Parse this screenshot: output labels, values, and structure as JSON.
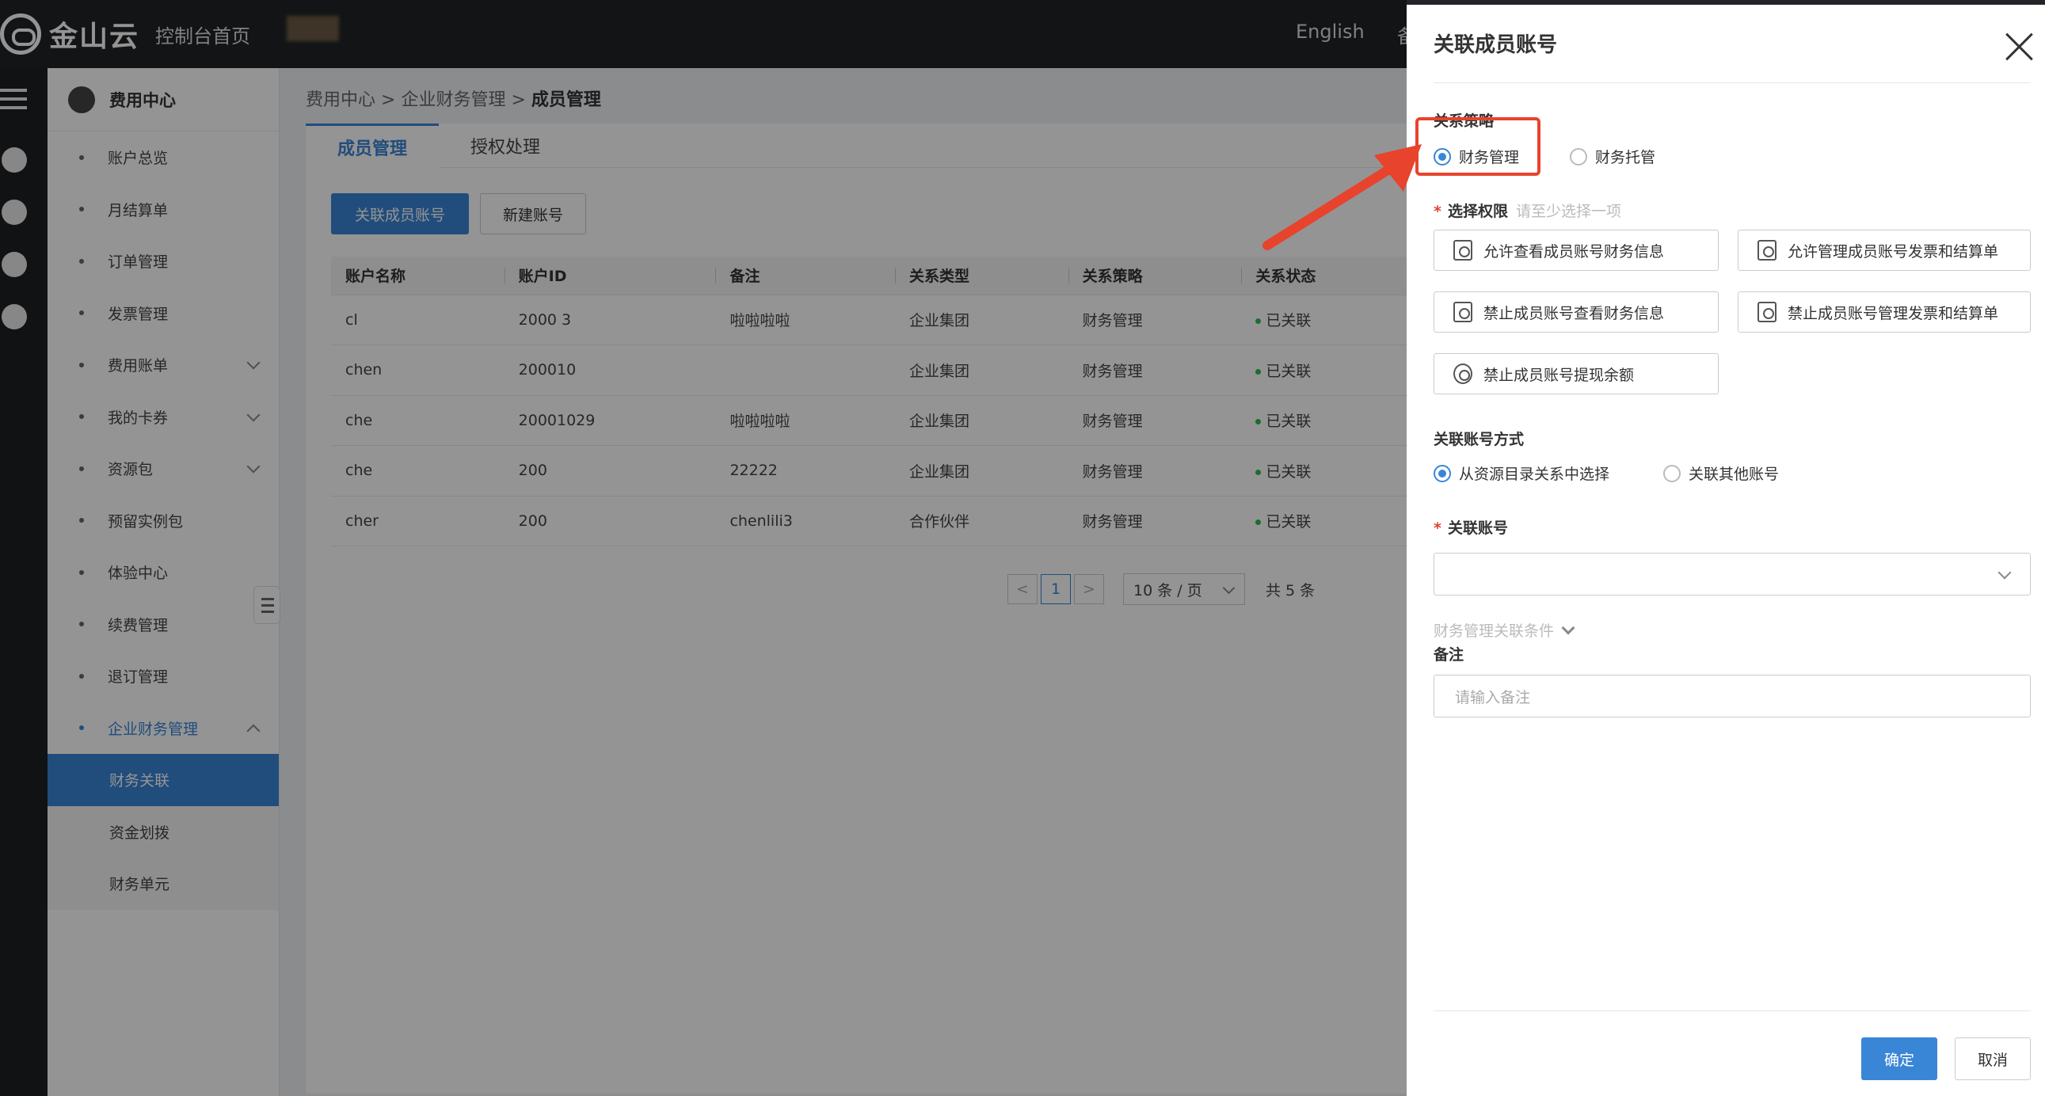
{
  "topbar": {
    "logo_text": "金山云",
    "console_home": "控制台首页",
    "language": "English",
    "partial_link": "备"
  },
  "sidebar": {
    "title": "费用中心",
    "items": [
      {
        "label": "账户总览"
      },
      {
        "label": "月结算单"
      },
      {
        "label": "订单管理"
      },
      {
        "label": "发票管理"
      },
      {
        "label": "费用账单"
      },
      {
        "label": "我的卡券"
      },
      {
        "label": "资源包"
      },
      {
        "label": "预留实例包"
      },
      {
        "label": "体验中心"
      },
      {
        "label": "续费管理"
      },
      {
        "label": "退订管理"
      },
      {
        "label": "企业财务管理"
      }
    ],
    "sub_items": [
      {
        "label": "财务关联"
      },
      {
        "label": "资金划拨"
      },
      {
        "label": "财务单元"
      }
    ]
  },
  "breadcrumb": {
    "part1": "费用中心",
    "sep": ">",
    "part2": "企业财务管理",
    "current": "成员管理"
  },
  "tabs": [
    {
      "label": "成员管理"
    },
    {
      "label": "授权处理"
    }
  ],
  "toolbar": {
    "link_member_button": "关联成员账号",
    "new_account_button": "新建账号"
  },
  "table": {
    "headers": [
      "账户名称",
      "账户ID",
      "备注",
      "关系类型",
      "关系策略",
      "关系状态"
    ],
    "rows": [
      [
        "cl",
        "2000      3",
        "啦啦啦啦",
        "企业集团",
        "财务管理",
        "已关联"
      ],
      [
        "chen",
        "200010",
        "",
        "企业集团",
        "财务管理",
        "已关联"
      ],
      [
        "che",
        "20001029",
        "啦啦啦啦",
        "企业集团",
        "财务管理",
        "已关联"
      ],
      [
        "che",
        "200",
        "22222",
        "企业集团",
        "财务管理",
        "已关联"
      ],
      [
        "cher",
        "200",
        "chenlili3",
        "合作伙伴",
        "财务管理",
        "已关联"
      ]
    ]
  },
  "pagination": {
    "prev": "<",
    "current": "1",
    "next": ">",
    "page_size": "10 条 / 页",
    "total": "共 5 条"
  },
  "drawer": {
    "title": "关联成员账号",
    "strategy_label": "关系策略",
    "strategy_options": [
      "财务管理",
      "财务托管"
    ],
    "permission_label": "选择权限",
    "permission_hint": "请至少选择一项",
    "permissions": [
      "允许查看成员账号财务信息",
      "允许管理成员账号发票和结算单",
      "禁止成员账号查看财务信息",
      "禁止成员账号管理发票和结算单",
      "禁止成员账号提现余额"
    ],
    "link_method_label": "关联账号方式",
    "link_method_options": [
      "从资源目录关系中选择",
      "关联其他账号"
    ],
    "account_label": "关联账号",
    "condition_label": "财务管理关联条件",
    "remark_label": "备注",
    "remark_placeholder": "请输入备注",
    "confirm_button": "确定",
    "cancel_button": "取消"
  },
  "colors": {
    "accent": "#3a86d6",
    "annotation": "#e8432c",
    "status_ok": "#34b853"
  }
}
